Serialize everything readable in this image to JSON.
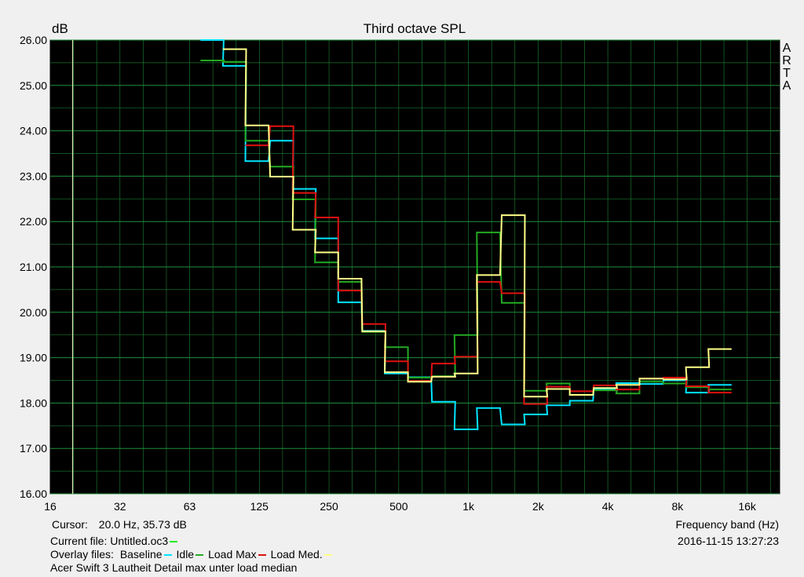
{
  "chart_data": {
    "type": "line",
    "title": "Third octave SPL",
    "ylabel": "dB",
    "xlabel": "Frequency band (Hz)",
    "watermark": "ARTA",
    "ylim": [
      16,
      26
    ],
    "y_ticks": [
      "16.00",
      "17.00",
      "18.00",
      "19.00",
      "20.00",
      "21.00",
      "22.00",
      "23.00",
      "24.00",
      "25.00",
      "26.00"
    ],
    "x_ticks": [
      "16",
      "32",
      "63",
      "125",
      "250",
      "500",
      "1k",
      "2k",
      "4k",
      "8k",
      "16k"
    ],
    "grid": true,
    "cursor_x": 20,
    "bands": [
      16,
      20,
      25,
      31.5,
      40,
      50,
      63,
      80,
      100,
      125,
      160,
      200,
      250,
      315,
      400,
      500,
      630,
      800,
      1000,
      1250,
      1600,
      2000,
      2500,
      3150,
      4000,
      5000,
      6300,
      8000,
      10000,
      12500,
      16000,
      20000
    ],
    "series": [
      {
        "name": "Baseline",
        "color": "#00e5ff",
        "start": 7,
        "values": [
          26.0,
          25.43,
          23.33,
          23.78,
          22.72,
          21.63,
          20.22,
          19.59,
          18.65,
          18.57,
          18.03,
          17.42,
          17.89,
          17.53,
          17.75,
          17.95,
          18.05,
          18.3,
          18.44,
          18.42,
          18.5,
          18.23,
          18.4
        ]
      },
      {
        "name": "Idle",
        "color": "#22aa22",
        "start": 7,
        "values": [
          25.55,
          25.52,
          23.78,
          23.21,
          22.49,
          21.1,
          20.67,
          19.57,
          19.23,
          18.56,
          18.59,
          19.5,
          21.76,
          20.21,
          18.27,
          18.43,
          18.18,
          18.28,
          18.21,
          18.47,
          18.43,
          18.35,
          18.3
        ]
      },
      {
        "name": "Load Max",
        "color": "#dd1111",
        "start": 9,
        "values": [
          23.68,
          24.1,
          22.63,
          22.09,
          20.48,
          19.74,
          18.92,
          18.49,
          18.87,
          19.02,
          20.67,
          20.42,
          17.98,
          18.36,
          18.26,
          18.39,
          18.3,
          18.54,
          18.56,
          18.37,
          18.23
        ]
      },
      {
        "name": "Load Med.",
        "color": "#ffff88",
        "start": 8,
        "values": [
          25.8,
          24.12,
          22.99,
          21.82,
          21.32,
          20.74,
          19.58,
          18.68,
          18.47,
          18.58,
          18.65,
          20.82,
          22.14,
          18.14,
          18.31,
          18.18,
          18.33,
          18.4,
          18.54,
          18.52,
          18.79,
          19.19
        ]
      }
    ]
  },
  "footer": {
    "cursor_label": "Cursor:",
    "cursor_value": "20.0 Hz, 35.73 dB",
    "freq_band_label": "Frequency band (Hz)",
    "current_file_label": "Current file: Untitled.oc3",
    "current_file_color": "#22ee22",
    "overlay_label": "Overlay files:",
    "datetime": "2016-11-15  13:27:23",
    "description": "Acer Swift 3 Lautheit Detail max unter load median"
  }
}
